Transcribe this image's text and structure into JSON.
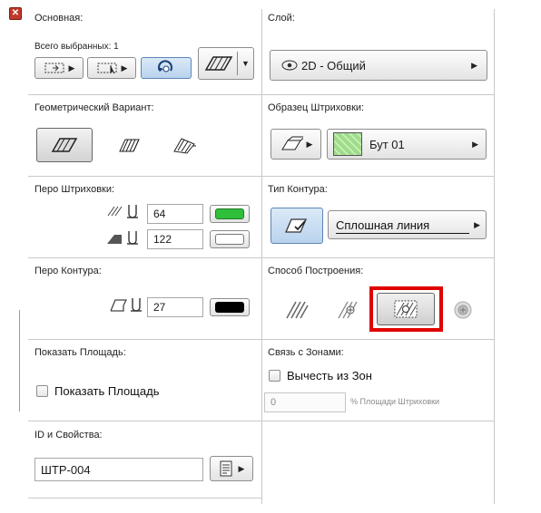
{
  "basic": {
    "title": "Основная:",
    "selected_count": "Всего выбранных: 1"
  },
  "layer": {
    "title": "Слой:",
    "value": "2D - Общий",
    "icon": "eye-icon"
  },
  "geometry": {
    "title": "Геометрический Вариант:"
  },
  "hatch_pattern": {
    "title": "Образец Штриховки:",
    "value": "Бут 01",
    "swatch_color": "#9edc8a"
  },
  "hatch_pen": {
    "title": "Перо Штриховки:",
    "fill_pen": "64",
    "bg_pen": "122",
    "fill_pen_color": "#2fbf3b",
    "bg_pen_color": "#ffffff"
  },
  "contour_type": {
    "title": "Тип Контура:",
    "value": "Сплошная линия"
  },
  "contour_pen": {
    "title": "Перо Контура:",
    "value": "27",
    "color": "#000000"
  },
  "build_method": {
    "title": "Способ Построения:"
  },
  "show_area": {
    "title": "Показать Площадь:",
    "checkbox_label": "Показать Площадь"
  },
  "zones": {
    "title": "Связь с Зонами:",
    "checkbox_label": "Вычесть из Зон",
    "percent_value": "0",
    "percent_label": "% Площади Штриховки"
  },
  "id_props": {
    "title": "ID и Свойства:",
    "value": "ШТР-004"
  },
  "colors": {
    "accent_highlight": "#e00000",
    "selected_button": "#b9d3ee"
  }
}
